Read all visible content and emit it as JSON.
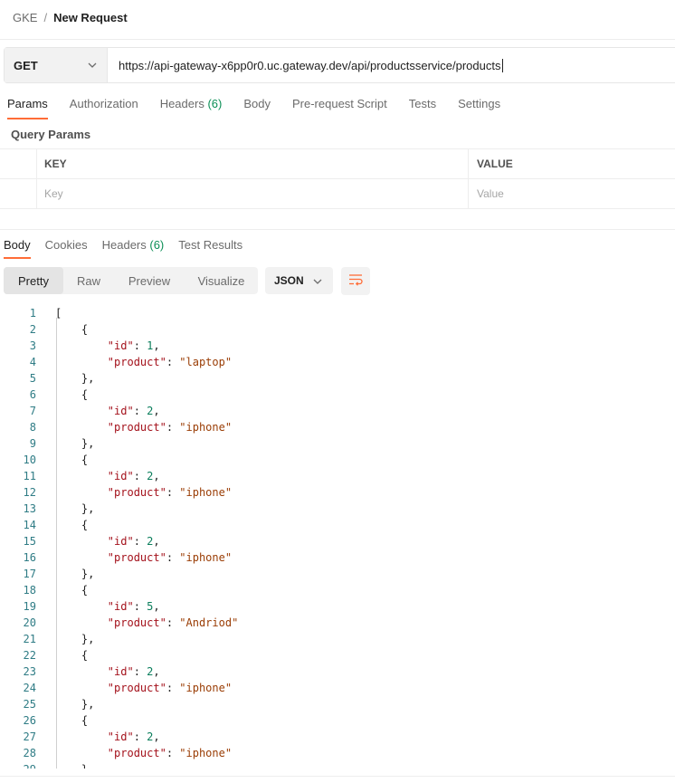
{
  "breadcrumb": {
    "parent": "GKE",
    "separator": "/",
    "current": "New Request"
  },
  "request": {
    "method": "GET",
    "url": "https://api-gateway-x6pp0r0.uc.gateway.dev/api/productsservice/products"
  },
  "request_tabs": [
    {
      "label": "Params",
      "count": ""
    },
    {
      "label": "Authorization",
      "count": ""
    },
    {
      "label": "Headers",
      "count": "(6)"
    },
    {
      "label": "Body",
      "count": ""
    },
    {
      "label": "Pre-request Script",
      "count": ""
    },
    {
      "label": "Tests",
      "count": ""
    },
    {
      "label": "Settings",
      "count": ""
    }
  ],
  "query_params": {
    "title": "Query Params",
    "columns": [
      "KEY",
      "VALUE"
    ],
    "key_placeholder": "Key",
    "value_placeholder": "Value"
  },
  "response_tabs": [
    {
      "label": "Body",
      "count": ""
    },
    {
      "label": "Cookies",
      "count": ""
    },
    {
      "label": "Headers",
      "count": "(6)"
    },
    {
      "label": "Test Results",
      "count": ""
    }
  ],
  "format_buttons": [
    "Pretty",
    "Raw",
    "Preview",
    "Visualize"
  ],
  "language": "JSON",
  "response_lines": [
    "[",
    "    {",
    "        \"id\": 1,",
    "        \"product\": \"laptop\"",
    "    },",
    "    {",
    "        \"id\": 2,",
    "        \"product\": \"iphone\"",
    "    },",
    "    {",
    "        \"id\": 2,",
    "        \"product\": \"iphone\"",
    "    },",
    "    {",
    "        \"id\": 2,",
    "        \"product\": \"iphone\"",
    "    },",
    "    {",
    "        \"id\": 5,",
    "        \"product\": \"Andriod\"",
    "    },",
    "    {",
    "        \"id\": 2,",
    "        \"product\": \"iphone\"",
    "    },",
    "    {",
    "        \"id\": 2,",
    "        \"product\": \"iphone\"",
    "    },"
  ],
  "colors": {
    "accent": "#ff6c37",
    "count": "#0c8f56",
    "json_key": "#a4121c",
    "json_number": "#0b7e5c",
    "json_string": "#9a3d05",
    "line_number": "#2f7c85"
  }
}
